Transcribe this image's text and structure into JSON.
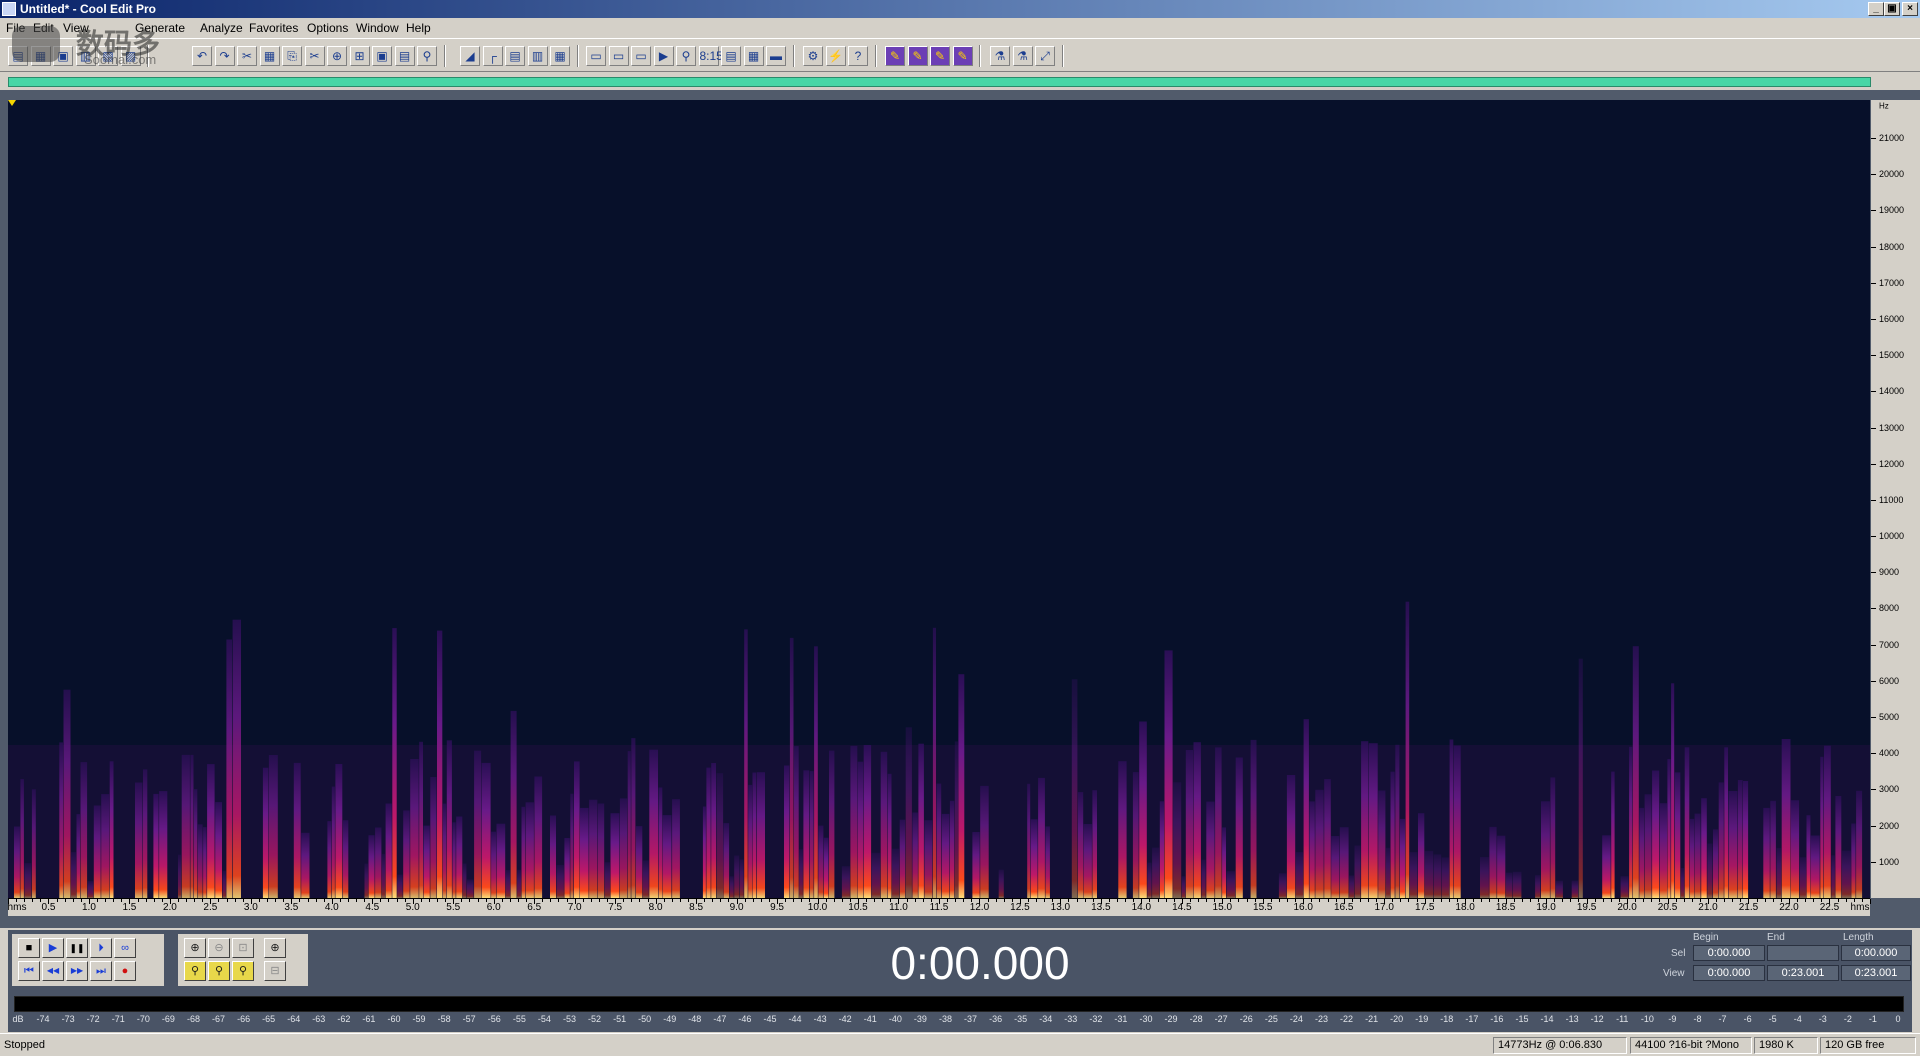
{
  "window": {
    "title": "Untitled* - Cool Edit Pro",
    "controls": [
      "_",
      "▣",
      "×"
    ]
  },
  "menu": [
    "File",
    "Edit",
    "View",
    "Generate",
    "Analyze",
    "Favorites",
    "Options",
    "Window",
    "Help"
  ],
  "watermark": {
    "brand": "数码多",
    "url": "Soomal.com"
  },
  "toolbar": {
    "group1": [
      "▤",
      "▦",
      "▣",
      "▥",
      "▧",
      "▨"
    ],
    "group2": [
      "↶",
      "↷",
      "✂",
      "▦",
      "⎘",
      "✂",
      "⊕",
      "⊞",
      "▣",
      "▤",
      "⚲"
    ],
    "group3": [
      "◢",
      "┌",
      "▤",
      "▥",
      "▦"
    ],
    "group4": [
      "▭",
      "▭",
      "▭",
      "▶",
      "⚲",
      "8:15",
      "▤",
      "▦",
      "▬"
    ],
    "group5": [
      "⚙",
      "⚡",
      "?"
    ],
    "group6": [
      "✎",
      "✎",
      "✎",
      "✎"
    ],
    "group7": [
      "⚗",
      "⚗",
      "⤢"
    ]
  },
  "freq_axis": {
    "unit": "Hz",
    "labels": [
      "21000",
      "20000",
      "19000",
      "18000",
      "17000",
      "16000",
      "15000",
      "14000",
      "13000",
      "12000",
      "11000",
      "10000",
      "9000",
      "8000",
      "7000",
      "6000",
      "5000",
      "4000",
      "3000",
      "2000",
      "1000"
    ]
  },
  "time_axis": {
    "start_label": "hms",
    "end_label": "hms",
    "labels": [
      "0.5",
      "1.0",
      "1.5",
      "2.0",
      "2.5",
      "3.0",
      "3.5",
      "4.0",
      "4.5",
      "5.0",
      "5.5",
      "6.0",
      "6.5",
      "7.0",
      "7.5",
      "8.0",
      "8.5",
      "9.0",
      "9.5",
      "10.0",
      "10.5",
      "11.0",
      "11.5",
      "12.0",
      "12.5",
      "13.0",
      "13.5",
      "14.0",
      "14.5",
      "15.0",
      "15.5",
      "16.0",
      "16.5",
      "17.0",
      "17.5",
      "18.0",
      "18.5",
      "19.0",
      "19.5",
      "20.0",
      "20.5",
      "21.0",
      "21.5",
      "22.0",
      "22.5"
    ]
  },
  "transport": {
    "row1": [
      "■",
      "▶",
      "❚❚",
      "⏵",
      "∞"
    ],
    "row2": [
      "⏮",
      "◀◀",
      "▶▶",
      "⏭",
      "●"
    ],
    "zoom_row1": [
      "⊕",
      "⊖",
      "⊡",
      "⊕"
    ],
    "zoom_row2": [
      "⚲",
      "⚲",
      "⚲",
      "⊟"
    ]
  },
  "time_display": "0:00.000",
  "selection": {
    "headers": [
      "Begin",
      "End",
      "Length"
    ],
    "sel_label": "Sel",
    "view_label": "View",
    "sel": [
      "0:00.000",
      "",
      "0:00.000"
    ],
    "view": [
      "0:00.000",
      "0:23.001",
      "0:23.001"
    ]
  },
  "level_meter": {
    "labels": [
      "dB",
      "-74",
      "-73",
      "-72",
      "-71",
      "-70",
      "-69",
      "-68",
      "-67",
      "-66",
      "-65",
      "-64",
      "-63",
      "-62",
      "-61",
      "-60",
      "-59",
      "-58",
      "-57",
      "-56",
      "-55",
      "-54",
      "-53",
      "-52",
      "-51",
      "-50",
      "-49",
      "-48",
      "-47",
      "-46",
      "-45",
      "-44",
      "-43",
      "-42",
      "-41",
      "-40",
      "-39",
      "-38",
      "-37",
      "-36",
      "-35",
      "-34",
      "-33",
      "-32",
      "-31",
      "-30",
      "-29",
      "-28",
      "-27",
      "-26",
      "-25",
      "-24",
      "-23",
      "-22",
      "-21",
      "-20",
      "-19",
      "-18",
      "-17",
      "-16",
      "-15",
      "-14",
      "-13",
      "-12",
      "-11",
      "-10",
      "-9",
      "-8",
      "-7",
      "-6",
      "-5",
      "-4",
      "-3",
      "-2",
      "-1",
      "0"
    ]
  },
  "status": {
    "state": "Stopped",
    "cursor": "14773Hz @  0:06.830",
    "format": "44100 ?16-bit ?Mono",
    "size": "1980 K",
    "disk": "120 GB free"
  },
  "colors": {
    "spectrogram_bg": "#07102a",
    "overview_bar": "#47d6a6",
    "panel": "#4a5466",
    "chrome": "#d4d0c8"
  }
}
